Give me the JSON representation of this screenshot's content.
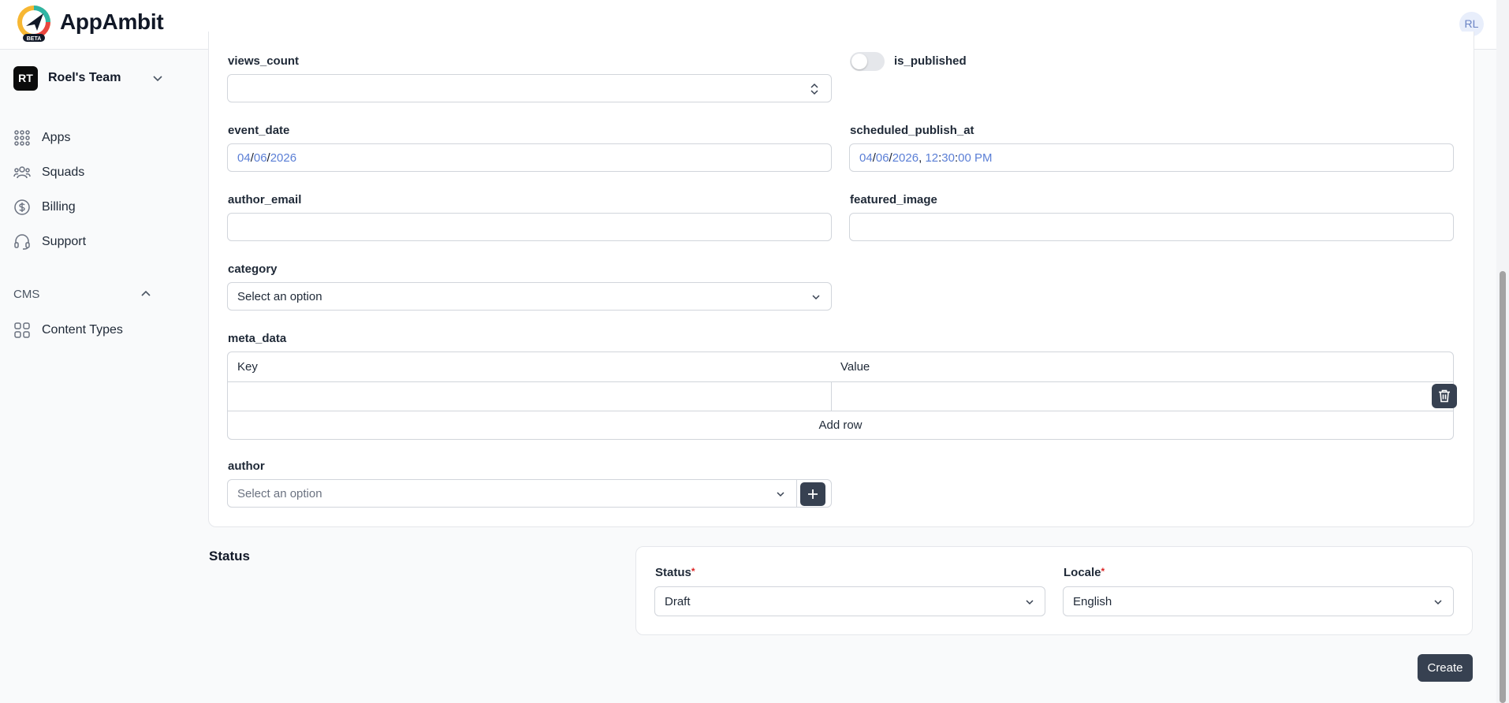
{
  "header": {
    "brand": "AppAmbit",
    "logo_badge": "BETA",
    "avatar_initials": "RL"
  },
  "sidebar": {
    "team": {
      "initials": "RT",
      "name": "Roel's Team"
    },
    "items": [
      {
        "label": "Apps",
        "icon": "grid-dots-icon"
      },
      {
        "label": "Squads",
        "icon": "users-icon"
      },
      {
        "label": "Billing",
        "icon": "dollar-circle-icon"
      },
      {
        "label": "Support",
        "icon": "headset-icon"
      }
    ],
    "section_title": "CMS",
    "section_items": [
      {
        "label": "Content Types",
        "icon": "grid-squares-icon"
      }
    ]
  },
  "form": {
    "views_count": {
      "label": "views_count",
      "value": ""
    },
    "is_published": {
      "label": "is_published",
      "checked": false
    },
    "event_date": {
      "label": "event_date",
      "month": "04",
      "day": "06",
      "year": "2026"
    },
    "scheduled_publish_at": {
      "label": "scheduled_publish_at",
      "month": "04",
      "day": "06",
      "year": "2026",
      "hour": "12",
      "minute": "30",
      "second": "00",
      "ampm": "PM"
    },
    "author_email": {
      "label": "author_email",
      "value": ""
    },
    "featured_image": {
      "label": "featured_image",
      "value": ""
    },
    "category": {
      "label": "category",
      "value": "Select an option"
    },
    "meta_data": {
      "label": "meta_data",
      "key_header": "Key",
      "value_header": "Value",
      "rows": [
        {
          "key": "",
          "value": ""
        }
      ],
      "add_row": "Add row"
    },
    "author": {
      "label": "author",
      "placeholder": "Select an option"
    }
  },
  "status_section": {
    "heading": "Status",
    "status": {
      "label": "Status",
      "value": "Draft",
      "required_mark": "*"
    },
    "locale": {
      "label": "Locale",
      "value": "English",
      "required_mark": "*"
    }
  },
  "actions": {
    "create": "Create"
  },
  "colors": {
    "accent_dark": "#374151",
    "date_segment": "#5b7fd6",
    "required": "#dc2626"
  }
}
